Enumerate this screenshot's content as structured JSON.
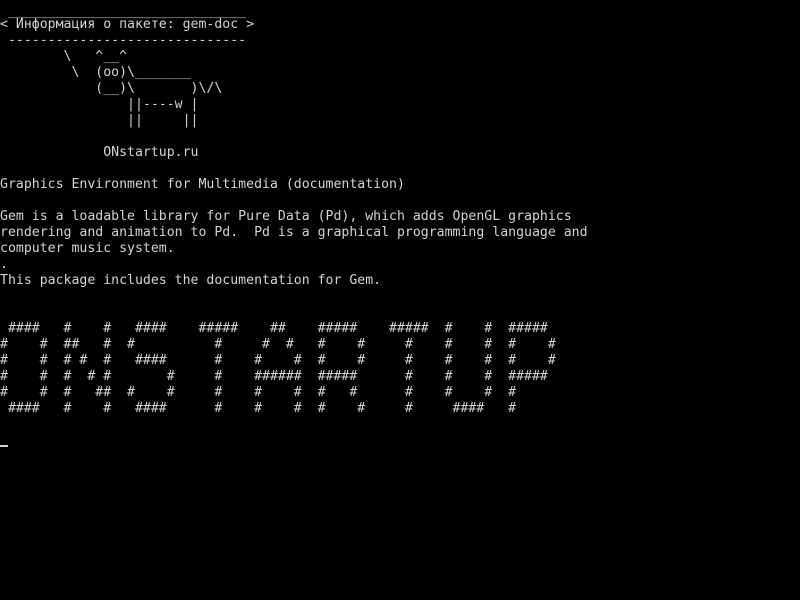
{
  "colors": {
    "background": "#000000",
    "foreground": "#d3d3d3"
  },
  "cowsay": {
    "bubble_top": " ______________________________",
    "bubble_text": "< Информация о пакете: gem-doc >",
    "bubble_bottom": " ------------------------------",
    "cow": [
      "        \\   ^__^",
      "         \\  (oo)\\_______",
      "            (__)\\       )\\/\\",
      "                ||----w |",
      "                ||     ||"
    ]
  },
  "site": "             ONstartup.ru",
  "package": {
    "summary": "Graphics Environment for Multimedia (documentation)",
    "description": [
      "Gem is a loadable library for Pure Data (Pd), which adds OpenGL graphics",
      "rendering and animation to Pd.  Pd is a graphical programming language and",
      "computer music system.",
      ".",
      "This package includes the documentation for Gem."
    ]
  },
  "banner": [
    " ####   #    #   ####    #####    ##    #####    #####  #    #  #####",
    "#    #  ##   #  #          #     #  #   #    #     #    #    #  #    #",
    "#    #  # #  #   ####      #    #    #  #    #     #    #    #  #    #",
    "#    #  #  # #       #     #    ######  #####      #    #    #  #####",
    "#    #  #   ##  #    #     #    #    #  #   #      #    #    #  #",
    " ####   #    #   ####      #    #    #  #    #     #     ####   #"
  ]
}
